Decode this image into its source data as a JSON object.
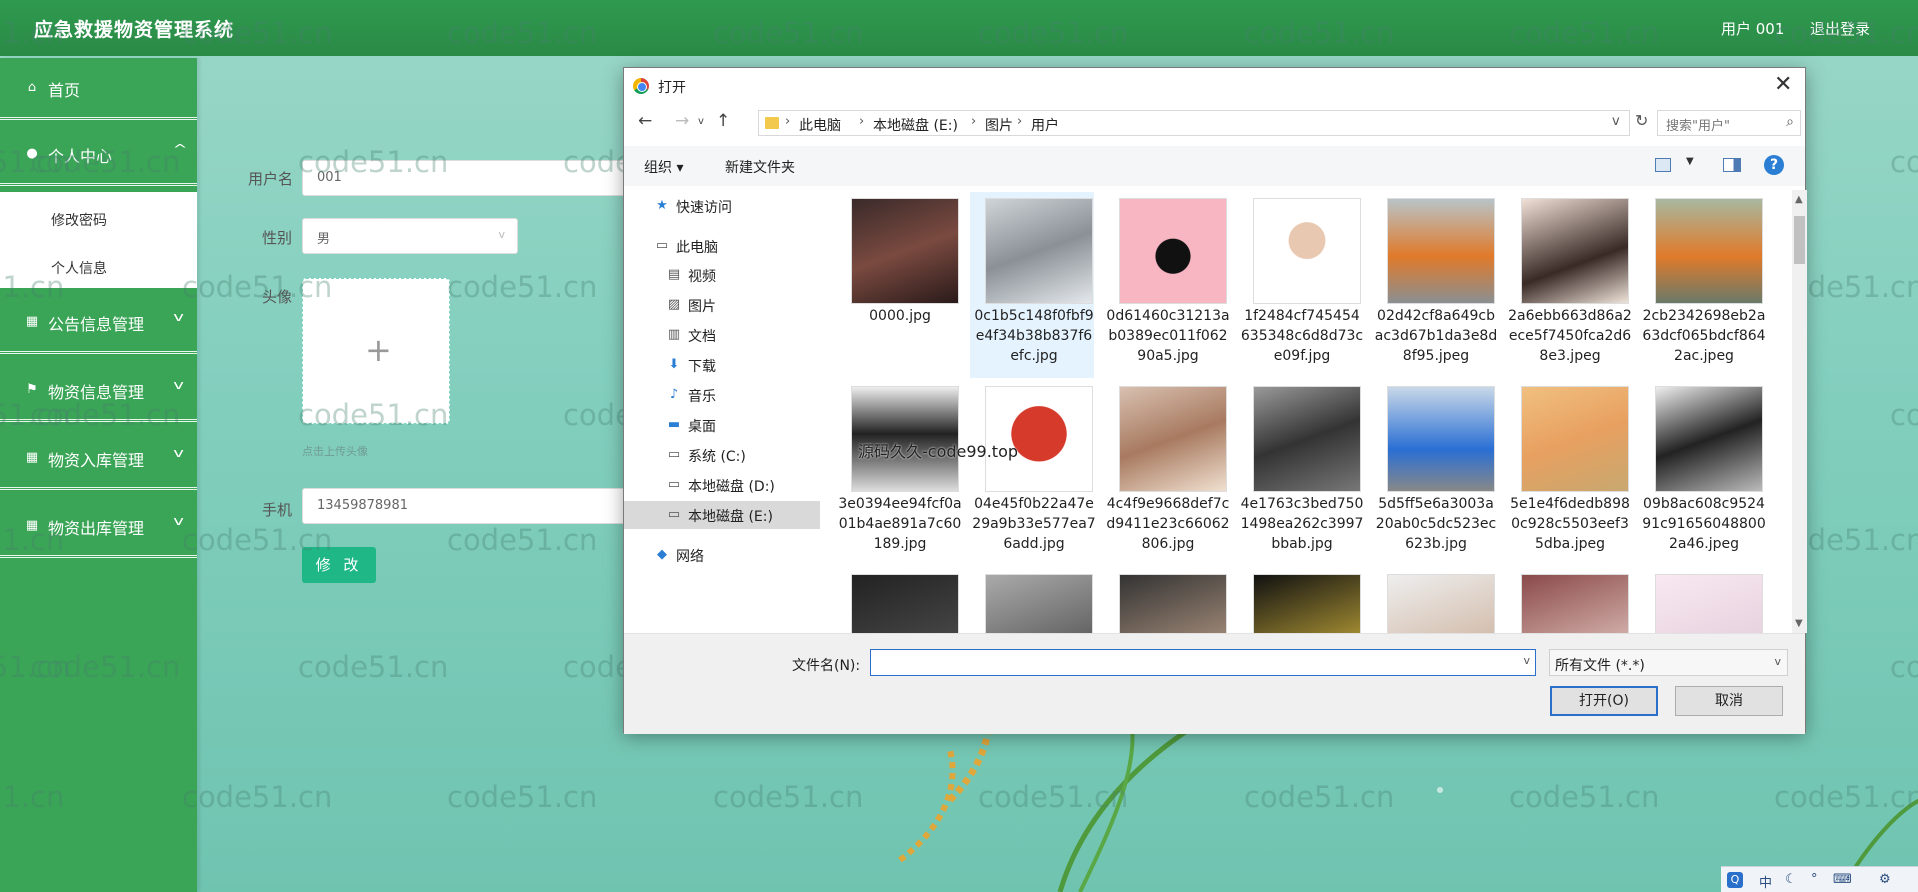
{
  "app": {
    "title": "应急救援物资管理系统",
    "user": "用户 001",
    "logout": "退出登录"
  },
  "sidebar": {
    "items": [
      {
        "label": "首页",
        "icon": "home-icon"
      },
      {
        "label": "个人中心",
        "icon": "user-icon"
      },
      {
        "label": "公告信息管理",
        "icon": "grid-icon"
      },
      {
        "label": "物资信息管理",
        "icon": "flag-icon"
      },
      {
        "label": "物资入库管理",
        "icon": "grid-icon"
      },
      {
        "label": "物资出库管理",
        "icon": "grid-icon"
      }
    ],
    "submenu": [
      "修改密码",
      "个人信息"
    ]
  },
  "form": {
    "username_label": "用户名",
    "username": "001",
    "gender_label": "性别",
    "gender": "男",
    "avatar_label": "头像",
    "upload_hint": "点击上传头像",
    "phone_label": "手机",
    "phone": "13459878981",
    "submit": "修 改"
  },
  "watermark": "code51.cn",
  "dialog": {
    "title": "打开",
    "breadcrumb": [
      "此电脑",
      "本地磁盘 (E:)",
      "图片",
      "用户"
    ],
    "search_placeholder": "搜索\"用户\"",
    "organize": "组织 ▾",
    "new_folder": "新建文件夹",
    "help": "?",
    "nav": [
      {
        "label": "快速访问",
        "icon": "star-icon"
      },
      {
        "label": "此电脑",
        "icon": "computer-icon"
      },
      {
        "label": "视频",
        "icon": "video-icon"
      },
      {
        "label": "图片",
        "icon": "picture-icon"
      },
      {
        "label": "文档",
        "icon": "document-icon"
      },
      {
        "label": "下载",
        "icon": "download-icon"
      },
      {
        "label": "音乐",
        "icon": "music-icon"
      },
      {
        "label": "桌面",
        "icon": "desktop-icon"
      },
      {
        "label": "系统 (C:)",
        "icon": "drive-icon"
      },
      {
        "label": "本地磁盘 (D:)",
        "icon": "drive-icon"
      },
      {
        "label": "本地磁盘 (E:)",
        "icon": "drive-icon"
      },
      {
        "label": "网络",
        "icon": "network-icon"
      }
    ],
    "files": [
      "0000.jpg",
      "0c1b5c148f0fbf9e4f34b38b837f6efc.jpg",
      "0d61460c31213ab0389ec011f06290a5.jpg",
      "1f2484cf745454635348c6d8d73ce09f.jpg",
      "02d42cf8a649cbac3d67b1da3e8d8f95.jpeg",
      "2a6ebb663d86a2ece5f7450fca2d68e3.jpeg",
      "2cb2342698eb2a63dcf065bdcf8642ac.jpeg",
      "3e0394ee94fcf0a01b4ae891a7c60189.jpg",
      "04e45f0b22a47e29a9b33e577ea76add.jpg",
      "4c4f9e9668def7cd9411e23c66062806.jpg",
      "4e1763c3bed7501498ea262c3997bbab.jpg",
      "5d5ff5e6a3003a20ab0c5dc523ec623b.jpg",
      "5e1e4f6dedb8980c928c5503eef35dba.jpeg",
      "09b8ac608c952491c916560488002a46.jpeg",
      "",
      "",
      "",
      "",
      "",
      "",
      ""
    ],
    "overlay_text": "源码久久-code99.top",
    "filename_label": "文件名(N):",
    "filename_value": "",
    "filter": "所有文件 (*.*)",
    "open": "打开(O)",
    "cancel": "取消"
  },
  "tray": [
    "中",
    "°",
    "⌨",
    "⚙"
  ],
  "colors": {
    "header": "#2f9a4f",
    "sidebar": "#3aa556",
    "button": "#1fb785",
    "dialog_accent": "#2a6fc9"
  }
}
